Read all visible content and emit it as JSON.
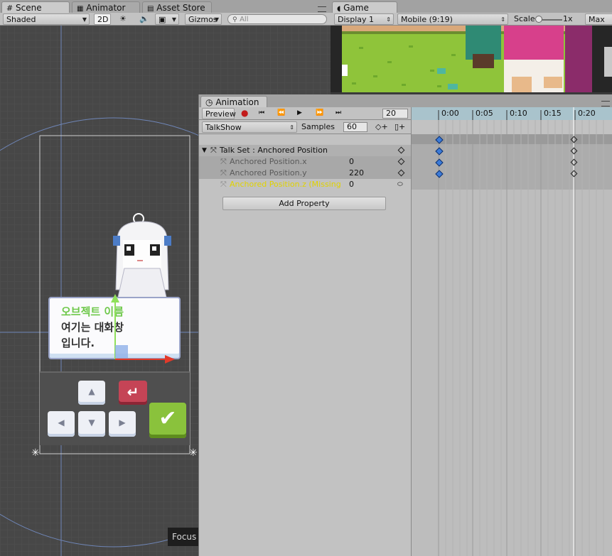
{
  "scene_tabs": [
    {
      "label": "Scene",
      "icon": "grid-icon"
    },
    {
      "label": "Animator",
      "icon": "animator-icon"
    },
    {
      "label": "Asset Store",
      "icon": "store-icon"
    }
  ],
  "game_tab": {
    "label": "Game",
    "icon": "pacman-icon"
  },
  "scene_toolbar": {
    "shading": "Shaded",
    "mode_2d": "2D",
    "gizmos": "Gizmos",
    "search_placeholder": "All"
  },
  "game_toolbar": {
    "display": "Display 1",
    "resolution": "Mobile (9:19)",
    "scale_label": "Scale",
    "scale_value": "1x",
    "maximize": "Max"
  },
  "ui_panel": {
    "object_name": "오브젝트 이름",
    "dialog_line1": "여기는 대화창",
    "dialog_line2": "입니다."
  },
  "focus_overlay": "Focus",
  "animation": {
    "tab_label": "Animation",
    "preview_label": "Preview",
    "frame": "20",
    "clip": "TalkShow",
    "samples_label": "Samples",
    "samples_value": "60",
    "timeline_labels": [
      "0:00",
      "0:05",
      "0:10",
      "0:15",
      "0:20"
    ],
    "properties": [
      {
        "name": "Talk Set : Anchored Position",
        "value": "",
        "kind": "group"
      },
      {
        "name": "Anchored Position.x",
        "value": "0",
        "kind": "child"
      },
      {
        "name": "Anchored Position.y",
        "value": "220",
        "kind": "child"
      },
      {
        "name": "Anchored Position.z (Missing",
        "value": "0",
        "kind": "missing"
      }
    ],
    "add_property": "Add Property"
  },
  "colors": {
    "accent_blue": "#3c7bd8",
    "object_name_green": "#6ec84a",
    "missing_yellow": "#e0d200",
    "record_red": "#c21b1b"
  }
}
